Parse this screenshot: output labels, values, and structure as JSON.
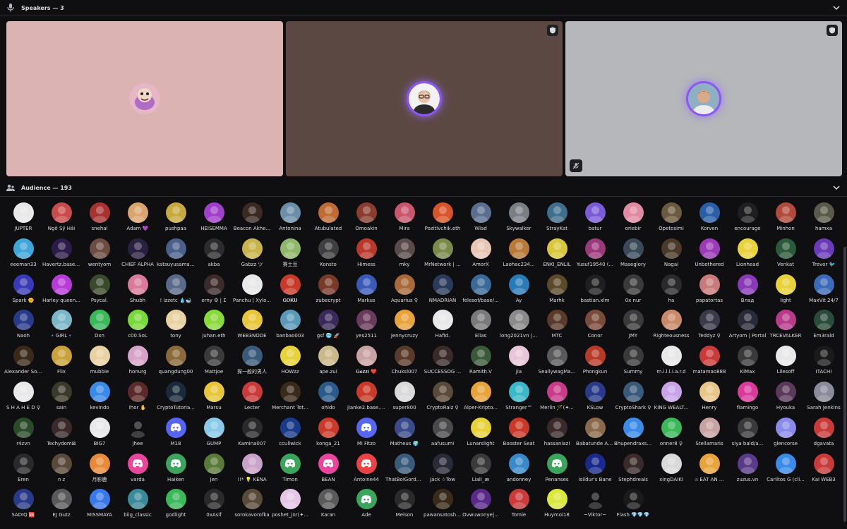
{
  "speakers": {
    "label": "Speakers — 3",
    "tiles": [
      {
        "bg": "#dbb3b2",
        "avatar": "#d7a0b6",
        "ring": false,
        "corner_icon": false,
        "mute_icon": false
      },
      {
        "bg": "#5c4843",
        "avatar": "#3b3b3b",
        "ring": true,
        "corner_icon": true,
        "mute_icon": false
      },
      {
        "bg": "#b5b7ba",
        "avatar": "#9ea3a8",
        "ring": true,
        "corner_icon": true,
        "mute_icon": true
      }
    ]
  },
  "audience": {
    "label": "Audience — 193",
    "members": [
      {
        "name": "JUPTER",
        "color": "#e8e8e8"
      },
      {
        "name": "Ngô Sỹ Hải",
        "color": "#c94b4b"
      },
      {
        "name": "snehal",
        "color": "#a83232"
      },
      {
        "name": "Adam 💜",
        "color": "#d9a56c"
      },
      {
        "name": "pushpaa",
        "color": "#c7a93d"
      },
      {
        "name": "HEISEMMA",
        "color": "#a03fc9"
      },
      {
        "name": "Beacon Akhe...",
        "color": "#3a2a22"
      },
      {
        "name": "Antonina",
        "color": "#6b8fa8"
      },
      {
        "name": "Atubulated",
        "color": "#c06a34"
      },
      {
        "name": "Omoakin",
        "color": "#8a3d2f"
      },
      {
        "name": "Mira",
        "color": "#c9556f"
      },
      {
        "name": "Pozitivchik.eth",
        "color": "#d8552b"
      },
      {
        "name": "Wlad",
        "color": "#5c6e8f"
      },
      {
        "name": "Skywalker",
        "color": "#7a7e85"
      },
      {
        "name": "StrayKat",
        "color": "#3f6f8c"
      },
      {
        "name": "batur",
        "color": "#7b5cd6"
      },
      {
        "name": "oriebir",
        "color": "#e08aa3"
      },
      {
        "name": "Opetosimi",
        "color": "#6a5a3f"
      },
      {
        "name": "Korven",
        "color": "#2b5ea8"
      },
      {
        "name": "encourage",
        "color": "#1f1f1f"
      },
      {
        "name": "Minhon",
        "color": "#b04a3b"
      },
      {
        "name": "hamxa",
        "color": "#5a5a4a"
      },
      {
        "name": "eeeman33",
        "color": "#3fa6d9"
      },
      {
        "name": "Havertz.base....",
        "color": "#2d1c4a"
      },
      {
        "name": "wentyom",
        "color": "#6d4c41"
      },
      {
        "name": "CHIEF ALPHA",
        "color": "#2a2040"
      },
      {
        "name": "katsuyusama ɛs",
        "color": "#4a5f8a"
      },
      {
        "name": "akba",
        "color": "#2c2c2c"
      },
      {
        "name": "Gabzz ツ",
        "color": "#c9b34a"
      },
      {
        "name": "赛土豆",
        "color": "#8fb86a"
      },
      {
        "name": "Konsto",
        "color": "#3f3f3f"
      },
      {
        "name": "Himess",
        "color": "#b8392b"
      },
      {
        "name": "mky",
        "color": "#5a4a4a"
      },
      {
        "name": "MrNetwork | ...",
        "color": "#7a8a4a"
      },
      {
        "name": "AmorX",
        "color": "#e8c6b6"
      },
      {
        "name": "Laohac234...",
        "color": "#b87a3a"
      },
      {
        "name": "ENKI_ENLIL",
        "color": "#d9c63a"
      },
      {
        "name": "Yusuf19540 (...",
        "color": "#9b3a7a"
      },
      {
        "name": "Maseglory",
        "color": "#3a4a5a"
      },
      {
        "name": "Nagai",
        "color": "#4a3a2a"
      },
      {
        "name": "Unbothered",
        "color": "#9d3ab8"
      },
      {
        "name": "Lionhead",
        "color": "#e8d23a"
      },
      {
        "name": "Venkat",
        "color": "#2a5a3a"
      },
      {
        "name": "Trevor 🐦",
        "color": "#6a3ab8"
      },
      {
        "name": "Spark 🌞",
        "color": "#3a3ab8"
      },
      {
        "name": "Harley queen...",
        "color": "#b83ad9"
      },
      {
        "name": "Psycal.",
        "color": "#3a4a2a"
      },
      {
        "name": "Shubh",
        "color": "#d97a9b"
      },
      {
        "name": "! izzetc 💧🐋",
        "color": "#5a6a8a"
      },
      {
        "name": "erny ⚙ | Σ",
        "color": "#3a2a2a"
      },
      {
        "name": "Panchu | Xylo...",
        "color": "#e8e8e8"
      },
      {
        "name": "𝐆𝐎𝐊𝐔",
        "color": "#c93a2a"
      },
      {
        "name": "zubecrypt",
        "color": "#7a3a2a"
      },
      {
        "name": "Markus",
        "color": "#3a5ab8"
      },
      {
        "name": "Aquarius ♀",
        "color": "#a86a3a"
      },
      {
        "name": "NMADRIAN",
        "color": "#2a3a5a"
      },
      {
        "name": "felesof/base/...",
        "color": "#3a6a9a"
      },
      {
        "name": "Ay",
        "color": "#2a7ab8"
      },
      {
        "name": "Marhk",
        "color": "#5a4a2a"
      },
      {
        "name": "bastian.xlm",
        "color": "#1f1f1f"
      },
      {
        "name": "0x nur",
        "color": "#3a3a3a"
      },
      {
        "name": "ha",
        "color": "#2a2a2a"
      },
      {
        "name": "papatortas",
        "color": "#c97a7a"
      },
      {
        "name": "Влад",
        "color": "#8a3ab8"
      },
      {
        "name": "light",
        "color": "#e8d23a"
      },
      {
        "name": "MaxVit 24/7",
        "color": "#3a6ab8"
      },
      {
        "name": "Naoh",
        "color": "#2a3a8a"
      },
      {
        "name": "🔹GIRL🔹",
        "color": "#7ab8c9"
      },
      {
        "name": "Dxn",
        "color": "#3ab85a"
      },
      {
        "name": "c00.SoL",
        "color": "#7ad93a"
      },
      {
        "name": "tony",
        "color": "#e8d2a3"
      },
      {
        "name": "juhan.eth",
        "color": "#8ad93a"
      },
      {
        "name": "WEB3NODE",
        "color": "#e8c63a"
      },
      {
        "name": "banbao003",
        "color": "#5a9ab8"
      },
      {
        "name": "gsf 🥶 🚀",
        "color": "#3a2a5a"
      },
      {
        "name": "yes2511",
        "color": "#6a3a5a"
      },
      {
        "name": "Jennycruzy",
        "color": "#e8a33a"
      },
      {
        "name": "Hafid.",
        "color": "#e8e8e8"
      },
      {
        "name": "Elias",
        "color": "#7a7a7a"
      },
      {
        "name": "long2021vn | ...",
        "color": "#8a8a8a"
      },
      {
        "name": "MTC",
        "color": "#5a3a2a"
      },
      {
        "name": "Conor",
        "color": "#7a4a3a"
      },
      {
        "name": "JMY",
        "color": "#3a3a3a"
      },
      {
        "name": "Righteousness",
        "color": "#c98a6a"
      },
      {
        "name": "Teddyz ♀",
        "color": "#3a3a4a"
      },
      {
        "name": "Artyom | Portal",
        "color": "#2a2a3a"
      },
      {
        "name": "TRCEVALKER",
        "color": "#b83a8a"
      },
      {
        "name": "Em3rald",
        "color": "#2a4a3a"
      },
      {
        "name": "Alexander Sol...",
        "color": "#3a2a1a"
      },
      {
        "name": "Flix",
        "color": "#c9a33a"
      },
      {
        "name": "mubbie",
        "color": "#e8d2a3"
      },
      {
        "name": "honurg",
        "color": "#d9a3c9"
      },
      {
        "name": "quangdung00",
        "color": "#8a6a3a"
      },
      {
        "name": "Mattjoe",
        "color": "#3a3a3a"
      },
      {
        "name": "探一般的男人",
        "color": "#3a5a7a"
      },
      {
        "name": "HOWzz",
        "color": "#e8d23a"
      },
      {
        "name": "ape.zui",
        "color": "#c9b88a"
      },
      {
        "name": "𝐆𝐞𝐳𝐳𝐢 ❤️",
        "color": "#c9a3a3"
      },
      {
        "name": "Chuksl007",
        "color": "#5a3a2a"
      },
      {
        "name": "SUCCESSOG ...",
        "color": "#3a2a2a"
      },
      {
        "name": "Ramith.V",
        "color": "#3a5a3a"
      },
      {
        "name": "Jia",
        "color": "#e8c6d9"
      },
      {
        "name": "SeallywagMa...",
        "color": "#5a5a5a"
      },
      {
        "name": "Phongkun",
        "color": "#b83a2a"
      },
      {
        "name": "Summy",
        "color": "#3a3a3a"
      },
      {
        "name": "m.i.l.l.i.a.r.d",
        "color": "#e8e8e8"
      },
      {
        "name": "matamao888",
        "color": "#c93a3a"
      },
      {
        "name": "KiMax",
        "color": "#3a3a3a"
      },
      {
        "name": "Lilesoff",
        "color": "#e8e8e8"
      },
      {
        "name": "ITACHI",
        "color": "#1a1a1a"
      },
      {
        "name": "S H A H E D ♀",
        "color": "#e8e8e8"
      },
      {
        "name": "sain",
        "color": "#3a3a2a"
      },
      {
        "name": "kevindo",
        "color": "#3a8ae8"
      },
      {
        "name": "Ihor ✋",
        "color": "#5a2a2a"
      },
      {
        "name": "CryptoTutoria...",
        "color": "#1a2a3a"
      },
      {
        "name": "Marsu",
        "color": "#e8c63a"
      },
      {
        "name": "Lecter",
        "color": "#c93a3a"
      },
      {
        "name": "Merchant Tot...",
        "color": "#3a2a1a"
      },
      {
        "name": "ohido",
        "color": "#2a5a8a"
      },
      {
        "name": "jianke2.base.e...",
        "color": "#c93a2a"
      },
      {
        "name": "super800",
        "color": "#d9d9d9"
      },
      {
        "name": "CryptoRaiz ♀",
        "color": "#5a4a3a"
      },
      {
        "name": "Alper-Kripto...",
        "color": "#e8a33a"
      },
      {
        "name": "Stranger™",
        "color": "#3ab8c9"
      },
      {
        "name": "Merlin 🪄(✦...",
        "color": "#c93a8a"
      },
      {
        "name": "KSLow",
        "color": "#2a3a8a"
      },
      {
        "name": "CryptoShark ♀",
        "color": "#3a5a7a"
      },
      {
        "name": "KING WEALT...",
        "color": "#c9a3e8"
      },
      {
        "name": "Henry",
        "color": "#e8c68a"
      },
      {
        "name": "flamingo",
        "color": "#d93a9b"
      },
      {
        "name": "Hyouka",
        "color": "#5a3a5a"
      },
      {
        "name": "Sarah Jenkins",
        "color": "#8a8a9a"
      },
      {
        "name": "r4zvn",
        "color": "#2a4a2a"
      },
      {
        "name": "Techydom⊠",
        "color": "#3a2a2a"
      },
      {
        "name": "BIG7",
        "color": "#e8e8e8"
      },
      {
        "name": "jhee",
        "color": "#0f0f11"
      },
      {
        "name": "M18",
        "color": "#5865f2"
      },
      {
        "name": "GUMP",
        "color": "#8ac9e8"
      },
      {
        "name": "Kamina007",
        "color": "#2a2a2a"
      },
      {
        "name": "ccullwick",
        "color": "#1a3a8a"
      },
      {
        "name": "konga_21",
        "color": "#c93a2a"
      },
      {
        "name": "Mi Fitzo",
        "color": "#5865f2"
      },
      {
        "name": "Matheus 🌍",
        "color": "#3a4a8a"
      },
      {
        "name": "aafusumi",
        "color": "#4a4a4a"
      },
      {
        "name": "Lunarslight",
        "color": "#e8d23a"
      },
      {
        "name": "Booster Seat",
        "color": "#c93a2a"
      },
      {
        "name": "hassaniazi",
        "color": "#3a2a2a"
      },
      {
        "name": "Babatunde Ak...",
        "color": "#8a6a4a"
      },
      {
        "name": "Bhupendraxsin...",
        "color": "#3a8ae8"
      },
      {
        "name": "onner8 ♀",
        "color": "#3ab85a"
      },
      {
        "name": "Stellamaris",
        "color": "#c9a3a3"
      },
      {
        "name": "siya bald/a...",
        "color": "#3a3a3a"
      },
      {
        "name": "glencorse",
        "color": "#8a8ae8"
      },
      {
        "name": "dgavata",
        "color": "#c93a3a"
      },
      {
        "name": "Eren",
        "color": "#2a2a2a"
      },
      {
        "name": "n z",
        "color": "#5a4a3a"
      },
      {
        "name": "月影鹿",
        "color": "#e88a3a"
      },
      {
        "name": "varda",
        "color": "#eb459e"
      },
      {
        "name": "Haiken",
        "color": "#3ba55d"
      },
      {
        "name": "jen",
        "color": "#5a7a3a"
      },
      {
        "name": "!!* 💡 KENA",
        "color": "#c9a3c9"
      },
      {
        "name": "Timon",
        "color": "#3ba55d"
      },
      {
        "name": "BEAN",
        "color": "#eb459e"
      },
      {
        "name": "Antoine44",
        "color": "#ed4245"
      },
      {
        "name": "ThatBoiGordo...",
        "color": "#3a5a7a"
      },
      {
        "name": "Jack ☆Tow",
        "color": "#2a2a3a"
      },
      {
        "name": "Liali_æ",
        "color": "#3a3a3a"
      },
      {
        "name": "andonney",
        "color": "#3a8ac9"
      },
      {
        "name": "Penanses",
        "color": "#3ba55d"
      },
      {
        "name": "Isildur's Bane",
        "color": "#1a2a8a"
      },
      {
        "name": "Stephdreals",
        "color": "#3a2a2a"
      },
      {
        "name": "xingDAIKI",
        "color": "#d9d9d9"
      },
      {
        "name": "ෆ EAT AN ...",
        "color": "#e8a33a"
      },
      {
        "name": "zuzus.vn",
        "color": "#5a3a8a"
      },
      {
        "name": "Carlitos G (cli...",
        "color": "#3a8ae8"
      },
      {
        "name": "Kai WEB3",
        "color": "#c93a3a"
      },
      {
        "name": "SADIQ 🆘",
        "color": "#2a3a8a"
      },
      {
        "name": "EJ Gutz",
        "color": "#5a5a5a"
      },
      {
        "name": "MISSMAYA",
        "color": "#3a7ae8"
      },
      {
        "name": "biig_classic",
        "color": "#3a8a9a"
      },
      {
        "name": "godlight",
        "color": "#3ab85a"
      },
      {
        "name": "0xAsif",
        "color": "#2a2a2a"
      },
      {
        "name": "sorokavorofka",
        "color": "#5a4a3a"
      },
      {
        "name": "poshet_jnr(✦...",
        "color": "#e8c6e8"
      },
      {
        "name": "Karan",
        "color": "#5a5a5a"
      },
      {
        "name": "Ade",
        "color": "#3ba55d"
      },
      {
        "name": "Meison",
        "color": "#2a2a2a"
      },
      {
        "name": "pawansatoshi...",
        "color": "#3a2a1a"
      },
      {
        "name": "Ovwuwonye|...",
        "color": "#5a2a8a"
      },
      {
        "name": "Tomie",
        "color": "#c93a3a"
      },
      {
        "name": "Huymoi18",
        "color": "#d9e83a"
      },
      {
        "name": "~Viktor~",
        "color": "#0f0f11"
      },
      {
        "name": "Flash 💎💎💎",
        "color": "#1a1a1a"
      }
    ]
  }
}
